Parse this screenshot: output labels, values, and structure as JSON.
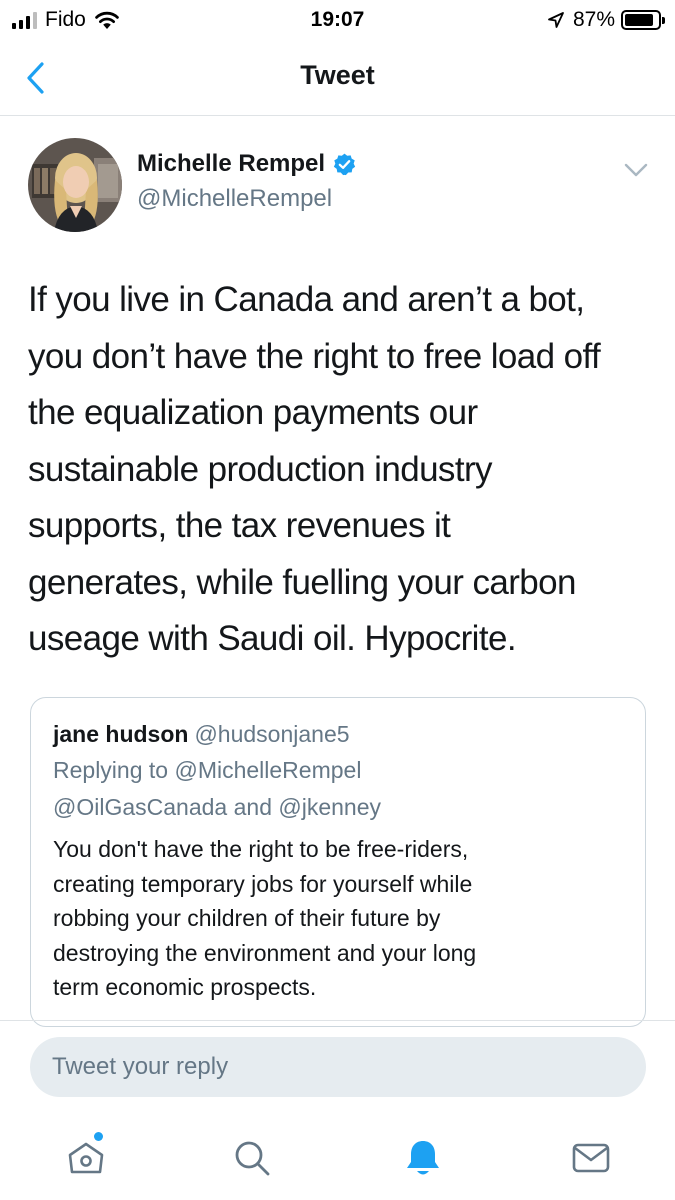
{
  "status_bar": {
    "carrier": "Fido",
    "time": "19:07",
    "battery_percent": "87%",
    "battery_level": 0.87,
    "signal_bars_active": 3,
    "signal_bars_total": 4
  },
  "nav": {
    "title": "Tweet",
    "back_icon": "chevron-left-icon"
  },
  "tweet": {
    "author_name": "Michelle Rempel",
    "author_handle": "@MichelleRempel",
    "verified": true,
    "text": "If you live in Canada and aren’t a bot,\nyou don’t have the right to free load off\nthe equalization payments our\nsustainable production industry\nsupports, the tax revenues it\ngenerates, while fuelling your carbon\nuseage with Saudi oil. Hypocrite."
  },
  "quoted_tweet": {
    "author_name": "jane hudson",
    "author_handle": "@hudsonjane5",
    "replying_to_prefix": "Replying to",
    "replying_to_1": "@MichelleRempel",
    "replying_to_2": "@OilGasCanada",
    "replying_to_and": "and",
    "replying_to_3": "@jkenney",
    "text": "You don't have the right to be free-riders,\ncreating temporary jobs for yourself while\nrobbing your children of their future by\ndestroying the environment and your long\nterm economic prospects."
  },
  "reply": {
    "placeholder": "Tweet your reply"
  },
  "tabs": [
    {
      "icon": "home-icon",
      "active": false,
      "has_notification_dot": true
    },
    {
      "icon": "search-icon",
      "active": false
    },
    {
      "icon": "bell-icon",
      "active": true
    },
    {
      "icon": "mail-icon",
      "active": false
    }
  ],
  "colors": {
    "accent": "#1da1f2",
    "text_primary": "#14171a",
    "text_secondary": "#657786",
    "border": "#ccd6dd",
    "reply_box_bg": "#e6ecf0"
  }
}
